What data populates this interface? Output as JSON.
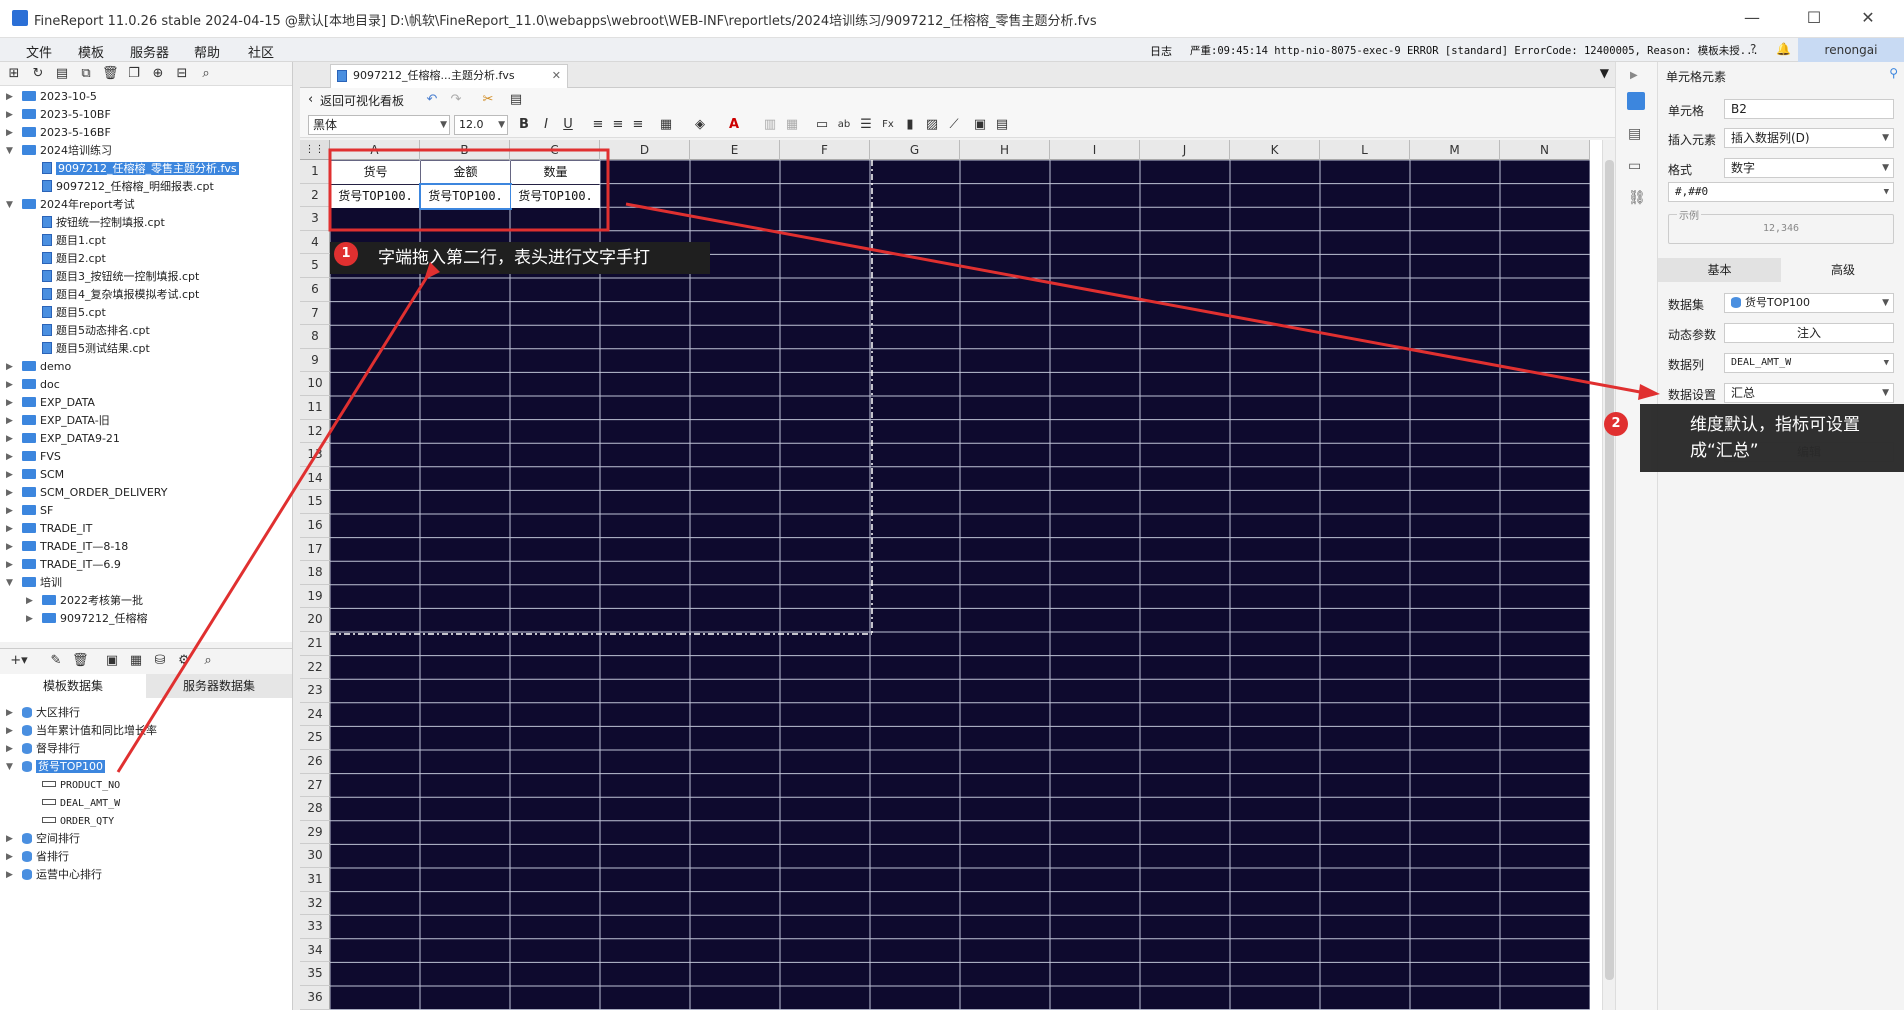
{
  "window": {
    "title": "FineReport 11.0.26 stable 2024-04-15 @默认[本地目录]    D:\\帆软\\FineReport_11.0\\webapps\\webroot\\WEB-INF\\reportlets/2024培训练习/9097212_任榕榕_零售主题分析.fvs",
    "minimize": "—",
    "maximize": "☐",
    "close": "✕"
  },
  "menu": {
    "items": [
      "文件",
      "模板",
      "服务器",
      "帮助",
      "社区"
    ],
    "log_label": "日志",
    "log_text": "严重:09:45:14 http-nio-8075-exec-9 ERROR [standard] ErrorCode: 12400005, Reason: 模板未授...",
    "user": "renongai"
  },
  "tree": {
    "items": [
      {
        "label": "2023-10-5",
        "kind": "folder",
        "level": 0
      },
      {
        "label": "2023-5-10BF",
        "kind": "folder",
        "level": 0
      },
      {
        "label": "2023-5-16BF",
        "kind": "folder",
        "level": 0
      },
      {
        "label": "2024培训练习",
        "kind": "folder",
        "level": 0,
        "open": true
      },
      {
        "label": "9097212_任榕榕_零售主题分析.fvs",
        "kind": "file",
        "level": 1,
        "selected": true
      },
      {
        "label": "9097212_任榕榕_明细报表.cpt",
        "kind": "file",
        "level": 1
      },
      {
        "label": "2024年report考试",
        "kind": "folder",
        "level": 0,
        "open": true
      },
      {
        "label": "按钮统一控制填报.cpt",
        "kind": "file",
        "level": 1
      },
      {
        "label": "题目1.cpt",
        "kind": "file",
        "level": 1
      },
      {
        "label": "题目2.cpt",
        "kind": "file",
        "level": 1
      },
      {
        "label": "题目3_按钮统一控制填报.cpt",
        "kind": "file",
        "level": 1
      },
      {
        "label": "题目4_复杂填报模拟考试.cpt",
        "kind": "file",
        "level": 1
      },
      {
        "label": "题目5.cpt",
        "kind": "file",
        "level": 1
      },
      {
        "label": "题目5动态排名.cpt",
        "kind": "file",
        "level": 1
      },
      {
        "label": "题目5测试结果.cpt",
        "kind": "file",
        "level": 1
      },
      {
        "label": "demo",
        "kind": "folder",
        "level": 0
      },
      {
        "label": "doc",
        "kind": "folder",
        "level": 0
      },
      {
        "label": "EXP_DATA",
        "kind": "folder",
        "level": 0
      },
      {
        "label": "EXP_DATA-旧",
        "kind": "folder",
        "level": 0
      },
      {
        "label": "EXP_DATA9-21",
        "kind": "folder",
        "level": 0
      },
      {
        "label": "FVS",
        "kind": "folder",
        "level": 0
      },
      {
        "label": "SCM",
        "kind": "folder",
        "level": 0
      },
      {
        "label": "SCM_ORDER_DELIVERY",
        "kind": "folder",
        "level": 0
      },
      {
        "label": "SF",
        "kind": "folder",
        "level": 0
      },
      {
        "label": "TRADE_IT",
        "kind": "folder",
        "level": 0
      },
      {
        "label": "TRADE_IT—8-18",
        "kind": "folder",
        "level": 0
      },
      {
        "label": "TRADE_IT—6.9",
        "kind": "folder",
        "level": 0
      },
      {
        "label": "培训",
        "kind": "folder",
        "level": 0,
        "open": true
      },
      {
        "label": "2022考核第一批",
        "kind": "folder",
        "level": 1
      },
      {
        "label": "9097212_任榕榕",
        "kind": "folder",
        "level": 1
      }
    ]
  },
  "datasets": {
    "tabs": [
      "模板数据集",
      "服务器数据集"
    ],
    "items": [
      {
        "label": "大区排行",
        "kind": "db",
        "level": 0
      },
      {
        "label": "当年累计值和同比增长率",
        "kind": "db",
        "level": 0
      },
      {
        "label": "督导排行",
        "kind": "db",
        "level": 0
      },
      {
        "label": "货号TOP100",
        "kind": "db",
        "level": 0,
        "selected": true,
        "open": true
      },
      {
        "label": "PRODUCT_NO",
        "kind": "col",
        "level": 1
      },
      {
        "label": "DEAL_AMT_W",
        "kind": "col",
        "level": 1
      },
      {
        "label": "ORDER_QTY",
        "kind": "col",
        "level": 1
      },
      {
        "label": "空间排行",
        "kind": "db",
        "level": 0
      },
      {
        "label": "省排行",
        "kind": "db",
        "level": 0
      },
      {
        "label": "运营中心排行",
        "kind": "db",
        "level": 0
      }
    ]
  },
  "document_tab": {
    "label": "9097212_任榕榕...主题分析.fvs",
    "close": "✕"
  },
  "toolbar": {
    "back_label": "返回可视化看板",
    "font_name": "黑体",
    "font_size": "12.0",
    "bold": "B",
    "italic": "I",
    "underline": "U"
  },
  "sheet": {
    "columns": [
      "A",
      "B",
      "C",
      "D",
      "E",
      "F",
      "G",
      "H",
      "I",
      "J",
      "K",
      "L",
      "M",
      "N"
    ],
    "rows": [
      "1",
      "2",
      "3",
      "4",
      "5",
      "6",
      "7",
      "8",
      "9",
      "10",
      "11",
      "12",
      "13",
      "14",
      "15",
      "16",
      "17",
      "18",
      "19",
      "20",
      "21",
      "22",
      "23",
      "24",
      "25",
      "26",
      "27",
      "28",
      "29",
      "30",
      "31",
      "32",
      "33",
      "34",
      "35",
      "36"
    ],
    "header_cells": [
      "货号",
      "金额",
      "数量"
    ],
    "data_cells": [
      "货号TOP100.",
      "货号TOP100.",
      "货号TOP100."
    ],
    "grid_color": "#0e0a2e"
  },
  "right_panel": {
    "title": "单元格元素",
    "cell_label": "单元格",
    "cell_value": "B2",
    "insert_label": "插入元素",
    "insert_value": "插入数据列(D)",
    "format_label": "格式",
    "format_value": "数字",
    "format_pattern": "#,##0",
    "example_label": "示例",
    "example_value": "12,346",
    "tabs": [
      "基本",
      "高级"
    ],
    "dataset_label": "数据集",
    "dataset_value": "货号TOP100",
    "dynparam_label": "动态参数",
    "dynparam_button": "注入",
    "datacol_label": "数据列",
    "datacol_value": "DEAL_AMT_W",
    "dataset_setting_label": "数据设置",
    "dataset_setting_value": "汇总",
    "edit_button": "编辑"
  },
  "callouts": {
    "c1_num": "1",
    "c1_text": "字端拖入第二行，表头进行文字手打",
    "c2_num": "2",
    "c2_line1": "维度默认，指标可设置",
    "c2_line2": "成“汇总”"
  },
  "colors": {
    "accent": "#3c86de",
    "annotation": "#e03030"
  }
}
